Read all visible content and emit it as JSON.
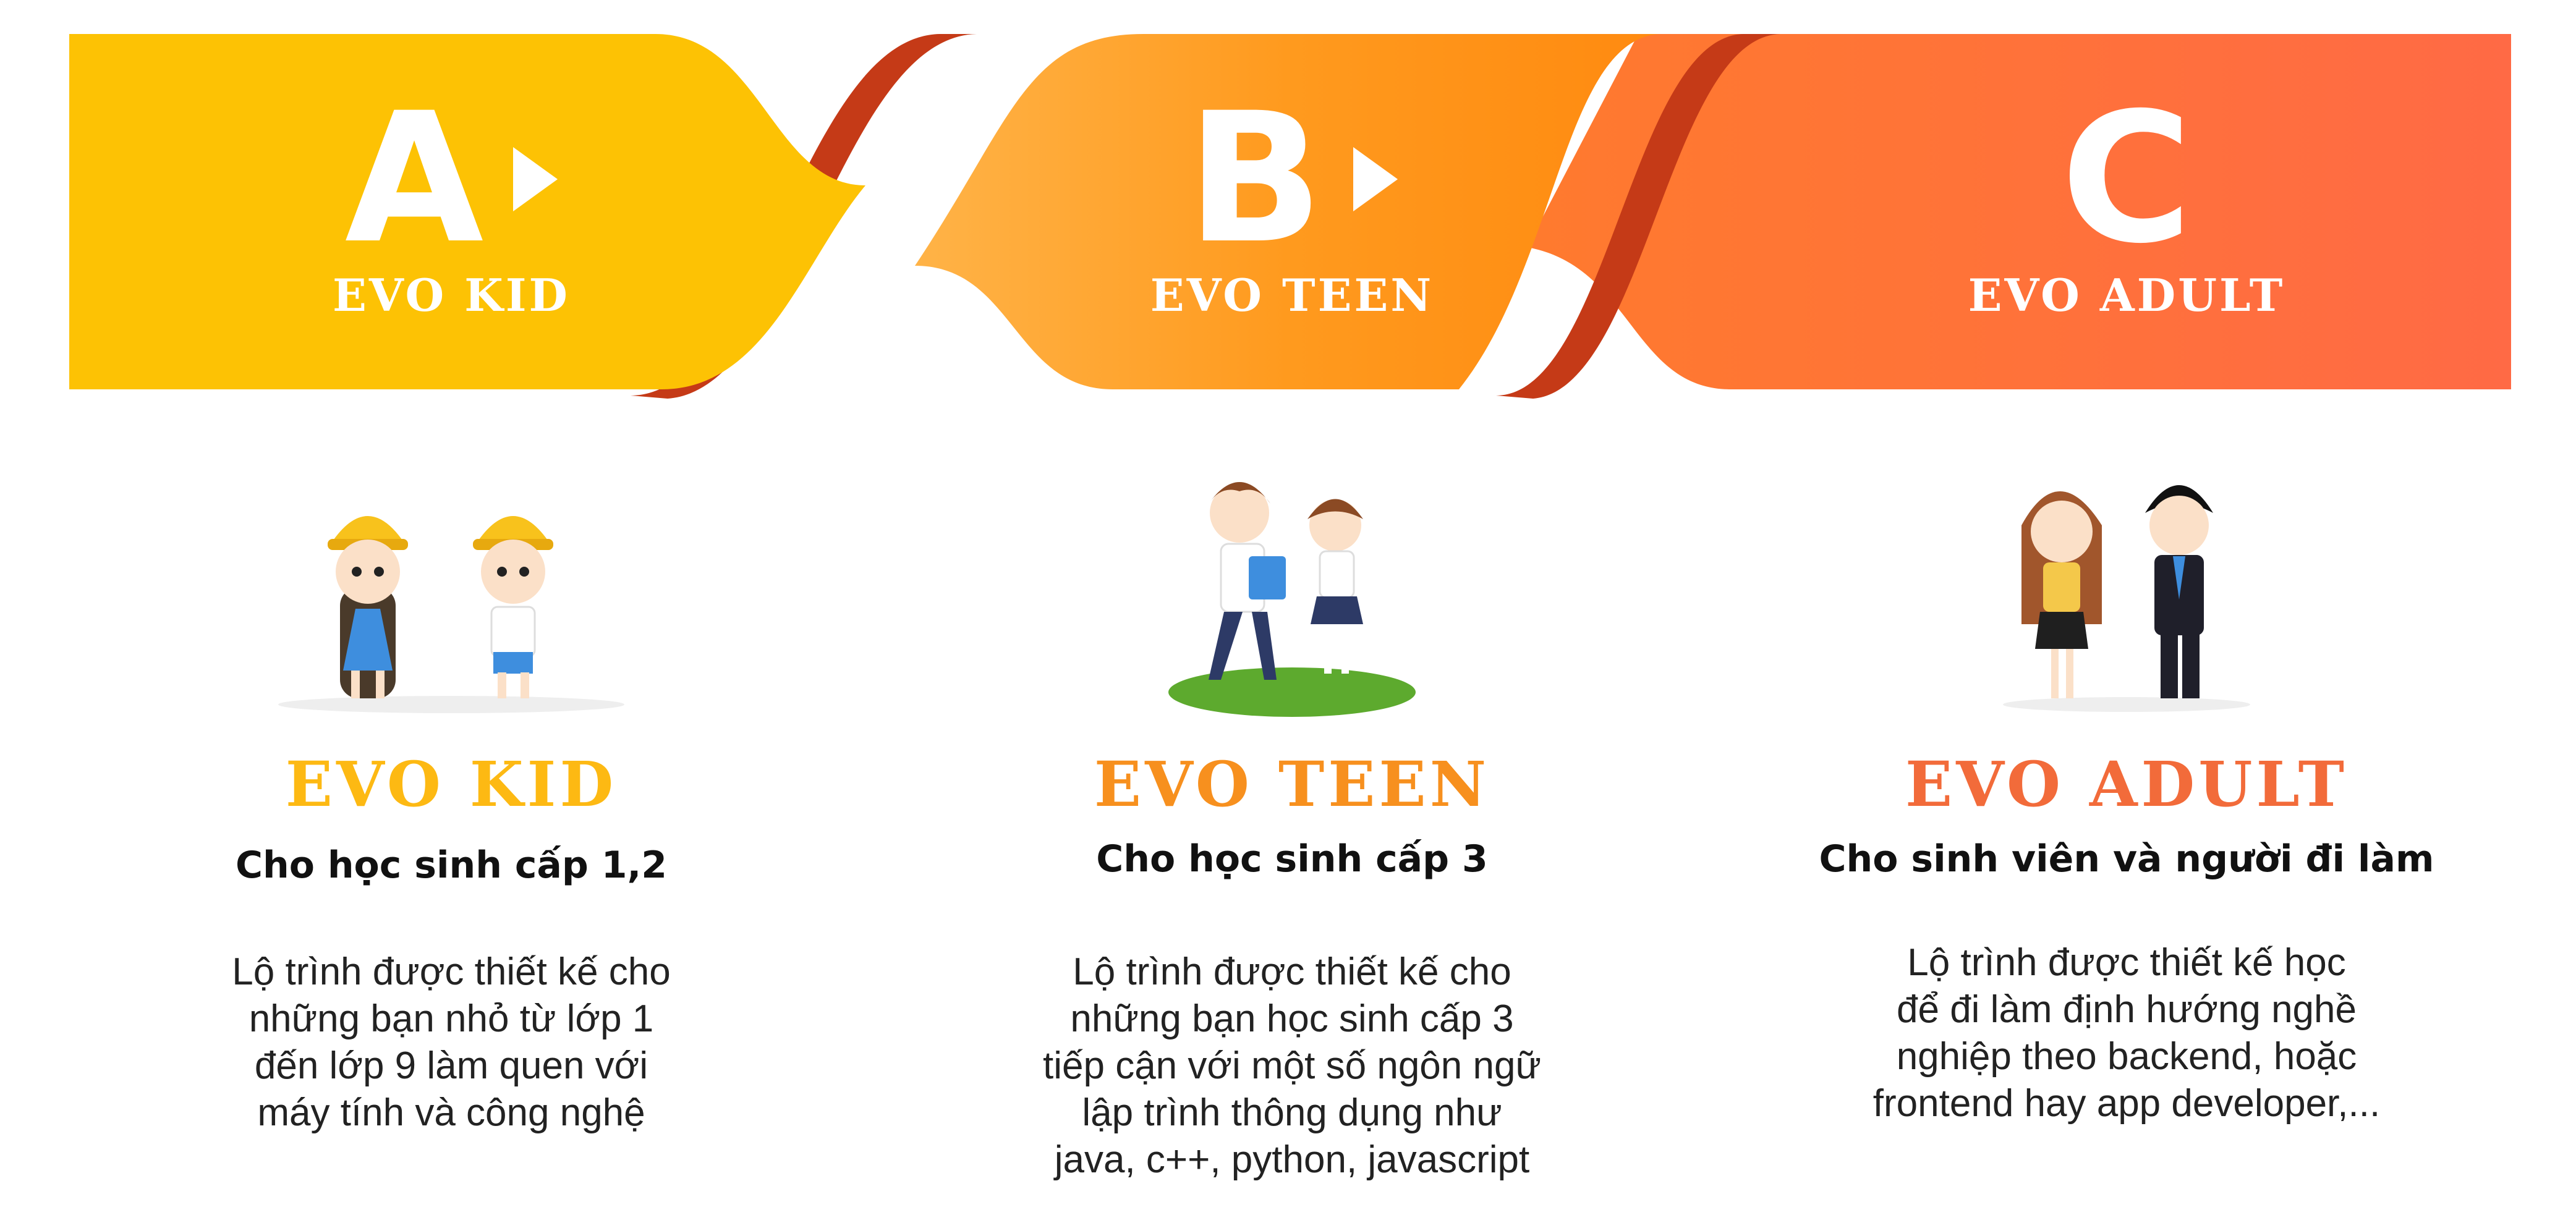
{
  "colors": {
    "kid": "#FDC204",
    "teen": "#FF8D14",
    "adult": "#FF6E3E",
    "kid_title": "#FDB913",
    "teen_title": "#F7901E",
    "adult_title": "#F26B3A",
    "ribbon_shadow": "#C53A17"
  },
  "banner": {
    "kid": {
      "letter": "A",
      "label": "EVO KID"
    },
    "teen": {
      "letter": "B",
      "label": "EVO TEEN"
    },
    "adult": {
      "letter": "C",
      "label": "EVO ADULT"
    }
  },
  "cards": {
    "kid": {
      "illustration": "two-kids-hardhats-illustration",
      "title": "EVO KID",
      "subtitle": "Cho học sinh cấp 1,2",
      "desc": [
        "Lộ trình được thiết kế cho",
        "những bạn nhỏ từ lớp 1",
        "đến lớp 9 làm quen với",
        "máy tính và công nghệ"
      ]
    },
    "teen": {
      "illustration": "teen-students-illustration",
      "title": "EVO TEEN",
      "subtitle": "Cho học sinh cấp 3",
      "desc": [
        "Lộ trình được thiết kế cho",
        "những bạn học sinh cấp 3",
        "tiếp cận với một số ngôn ngữ",
        "lập trình thông dụng như",
        "java, c++, python, javascript"
      ]
    },
    "adult": {
      "illustration": "adult-couple-illustration",
      "title": "EVO ADULT",
      "subtitle": "Cho sinh viên và người đi làm",
      "desc": [
        "Lộ trình được thiết kế học",
        "để đi làm định hướng nghề",
        "nghiệp theo backend, hoặc",
        "frontend hay app developer,..."
      ]
    }
  }
}
